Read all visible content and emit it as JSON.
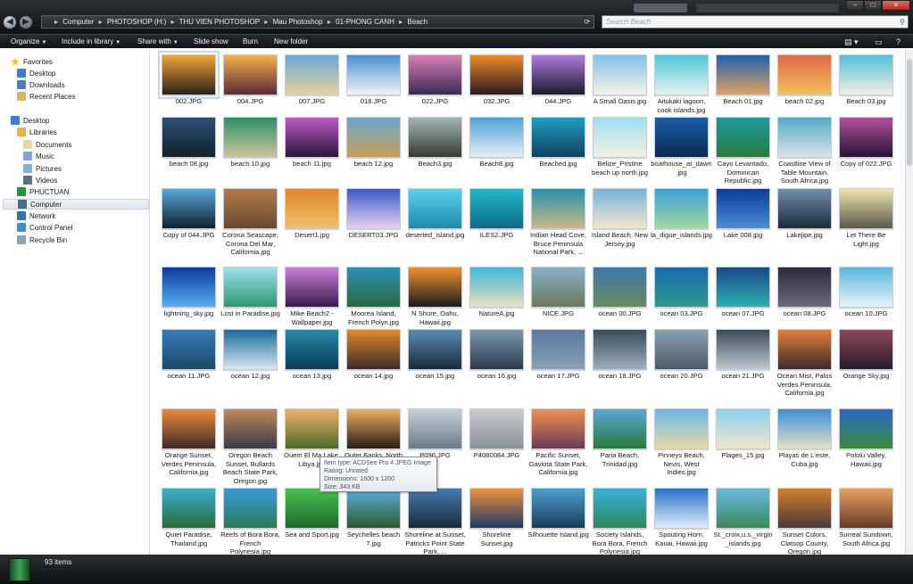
{
  "window": {
    "controls": {
      "min": "–",
      "max": "□",
      "close": "✕"
    }
  },
  "address": {
    "back_icon": "arrow-left-icon",
    "forward_icon": "arrow-right-icon",
    "crumbs": [
      "Computer",
      "PHOTOSHOP (H:)",
      "THU VIEN PHOTOSHOP",
      "Mau Photoshop",
      "01-PHONG CANH",
      "Beach"
    ],
    "separator": "▸",
    "search_placeholder": "Search Beach"
  },
  "toolbar": {
    "organize": "Organize",
    "include": "Include in library",
    "share": "Share with",
    "slideshow": "Slide show",
    "burn": "Burn",
    "newfolder": "New folder"
  },
  "nav": {
    "favorites": "Favorites",
    "desktop_fav": "Desktop",
    "downloads": "Downloads",
    "recent": "Recent Places",
    "desktop": "Desktop",
    "libraries": "Libraries",
    "documents": "Documents",
    "music": "Music",
    "pictures": "Pictures",
    "videos": "Videos",
    "user": "PHUCTUAN",
    "computer": "Computer",
    "network": "Network",
    "control": "Control Panel",
    "recycle": "Recycle Bin"
  },
  "tooltip": {
    "type": "Item type: ACDSee Pro 4 JPEG Image",
    "rating": "Rating: Unrated",
    "dims": "Dimensions: 1600 x 1200",
    "size": "Size: 343 KB"
  },
  "status": {
    "count": "93 items"
  },
  "files": [
    {
      "name": "002.JPG",
      "c1": "#f2a43a",
      "c2": "#2a1f1a"
    },
    {
      "name": "004.JPG",
      "c1": "#f6b04b",
      "c2": "#5a2a3a"
    },
    {
      "name": "007.JPG",
      "c1": "#6aa8d8",
      "c2": "#e6d29a"
    },
    {
      "name": "018.JPG",
      "c1": "#4a8fd0",
      "c2": "#f1f5f7"
    },
    {
      "name": "022.JPG",
      "c1": "#d77fb3",
      "c2": "#3a2a55"
    },
    {
      "name": "032.JPG",
      "c1": "#f08a2a",
      "c2": "#2a1a20"
    },
    {
      "name": "044.JPG",
      "c1": "#b07adf",
      "c2": "#1a1a2e"
    },
    {
      "name": "A Small Oasis.jpg",
      "c1": "#7fc3ea",
      "c2": "#f7f2e8"
    },
    {
      "name": "Aitukaki lagoon, cook islands.jpg",
      "c1": "#51c6d8",
      "c2": "#e5f4ef"
    },
    {
      "name": "Beach 01.jpg",
      "c1": "#1f5fb0",
      "c2": "#e0a060"
    },
    {
      "name": "beach 02.jpg",
      "c1": "#e06a4a",
      "c2": "#f2c15a"
    },
    {
      "name": "Beach 03.jpg",
      "c1": "#52c0d6",
      "c2": "#f4efe3"
    },
    {
      "name": "beach 08.jpg",
      "c1": "#2d4f78",
      "c2": "#12202d"
    },
    {
      "name": "beach 10.jpg",
      "c1": "#2b8f6a",
      "c2": "#d0c49a"
    },
    {
      "name": "beach 11.jpg",
      "c1": "#c05cc8",
      "c2": "#2a1638"
    },
    {
      "name": "beach 12.jpg",
      "c1": "#6aa6d0",
      "c2": "#caa052"
    },
    {
      "name": "Beach3.jpg",
      "c1": "#9fb5b8",
      "c2": "#3a3a2e"
    },
    {
      "name": "Beach8.jpg",
      "c1": "#4ea2d6",
      "c2": "#e6f0f5"
    },
    {
      "name": "Beached.jpg",
      "c1": "#1e9ec2",
      "c2": "#114060"
    },
    {
      "name": "Belize_Pristine beach up north.jpg",
      "c1": "#a0dff2",
      "c2": "#f3efe3"
    },
    {
      "name": "boathouse_at_dawn.jpg",
      "c1": "#1b5ea6",
      "c2": "#0a2a52"
    },
    {
      "name": "Cayo Levantado, Dominican Republic.jpg",
      "c1": "#1c9b9b",
      "c2": "#2a7a3a"
    },
    {
      "name": "Coastline View of Table Mountain, South Africa.jpg",
      "c1": "#56a9c8",
      "c2": "#d8e4e8"
    },
    {
      "name": "Copy of 022.JPG",
      "c1": "#b4509a",
      "c2": "#241436"
    },
    {
      "name": "Copy of 044.JPG",
      "c1": "#5aa8d8",
      "c2": "#102030"
    },
    {
      "name": "Corona Seascape, Corona Del Mar, California.jpg",
      "c1": "#b07a4a",
      "c2": "#6a4a30"
    },
    {
      "name": "Desert1.jpg",
      "c1": "#e0862a",
      "c2": "#f2c06a"
    },
    {
      "name": "DESERT03.JPG",
      "c1": "#3a5ac8",
      "c2": "#e8d0f0"
    },
    {
      "name": "deserted_island.jpg",
      "c1": "#5fd0ea",
      "c2": "#1a8ab0"
    },
    {
      "name": "ILES2.JPG",
      "c1": "#22b8c8",
      "c2": "#0c6a8a"
    },
    {
      "name": "Indian Head Cove, Bruce Peninsula National Park, ...",
      "c1": "#2a90a8",
      "c2": "#c9b98a"
    },
    {
      "name": "Island Beach, New Jersey.jpg",
      "c1": "#7ab4d8",
      "c2": "#efe6d0"
    },
    {
      "name": "la_digue_islands.jpg",
      "c1": "#3aa0d6",
      "c2": "#a0d8a0"
    },
    {
      "name": "Lake 008.jpg",
      "c1": "#0c3a9a",
      "c2": "#4a90d8"
    },
    {
      "name": "Lakejipe.jpg",
      "c1": "#6f8fa8",
      "c2": "#1a2a3a"
    },
    {
      "name": "Let There Be Light.jpg",
      "c1": "#f0e2b0",
      "c2": "#5a5a4a"
    },
    {
      "name": "lightning_sky.jpg",
      "c1": "#0a3aa0",
      "c2": "#58b0f0"
    },
    {
      "name": "Lost in Paradise.jpg",
      "c1": "#9ee0f0",
      "c2": "#2a9a6a"
    },
    {
      "name": "Mike Beach2 - Wallpaper.jpg",
      "c1": "#c880d8",
      "c2": "#3a1a4a"
    },
    {
      "name": "Moorea Island, French Polyn.jpg",
      "c1": "#2a8fb8",
      "c2": "#2a6a3a"
    },
    {
      "name": "N Shore, Oahu, Hawaii.jpg",
      "c1": "#f09030",
      "c2": "#1a1a22"
    },
    {
      "name": "NatureA.jpg",
      "c1": "#3fb8d8",
      "c2": "#e8e0c0"
    },
    {
      "name": "NICE.JPG",
      "c1": "#8ab0c8",
      "c2": "#6a7a5a"
    },
    {
      "name": "ocean 00.JPG",
      "c1": "#3a7ab0",
      "c2": "#6a8a5a"
    },
    {
      "name": "ocean 03.JPG",
      "c1": "#1a6ab0",
      "c2": "#2a9a8a"
    },
    {
      "name": "ocean 07.JPG",
      "c1": "#1a4a8a",
      "c2": "#2ab0b0"
    },
    {
      "name": "ocean 08.JPG",
      "c1": "#2a2a3a",
      "c2": "#6a6a7a"
    },
    {
      "name": "ocean 10.JPG",
      "c1": "#5ab8e0",
      "c2": "#e6f2f8"
    },
    {
      "name": "ocean 11.JPG",
      "c1": "#3a7ab8",
      "c2": "#1a4a6a"
    },
    {
      "name": "ocean 12.jpg",
      "c1": "#1a6a9a",
      "c2": "#d8e8f0"
    },
    {
      "name": "ocean 13.jpg",
      "c1": "#2a8aaa",
      "c2": "#0a3a5a"
    },
    {
      "name": "ocean 14.jpg",
      "c1": "#e08a2a",
      "c2": "#3a2a2a"
    },
    {
      "name": "ocean 15.jpg",
      "c1": "#5a8ab0",
      "c2": "#1a2a3a"
    },
    {
      "name": "ocean 16.jpg",
      "c1": "#7a9ab0",
      "c2": "#2a3a4a"
    },
    {
      "name": "ocean 17.JPG",
      "c1": "#5a7aa0",
      "c2": "#8aa0b8"
    },
    {
      "name": "ocean 18.JPG",
      "c1": "#3a4a5a",
      "c2": "#9ab0c0"
    },
    {
      "name": "ocean 20.JPG",
      "c1": "#8aa0b0",
      "c2": "#4a5a6a"
    },
    {
      "name": "ocean 21.JPG",
      "c1": "#3a4a5a",
      "c2": "#c0c8d0"
    },
    {
      "name": "Ocean Mist, Palos Verdes Peninsula, California.jpg",
      "c1": "#e08040",
      "c2": "#3a2a2a"
    },
    {
      "name": "Orange Sky.jpg",
      "c1": "#8a4a5a",
      "c2": "#2a1a2a"
    },
    {
      "name": "Orange Sunset, Verdes Peninsula, California.jpg",
      "c1": "#f08a3a",
      "c2": "#3a2a2a"
    },
    {
      "name": "Oregon Beach Sunset, Bullards Beach State Park, Oregon.jpg",
      "c1": "#c08a5a",
      "c2": "#3a3a4a"
    },
    {
      "name": "Ouem El Ma Lake, Libya.jpg",
      "c1": "#f0b06a",
      "c2": "#4a6a2a"
    },
    {
      "name": "Outer Banks, North Carolina.jpg",
      "c1": "#f0b060",
      "c2": "#2a1a1a"
    },
    {
      "name": "P096.JPG",
      "c1": "#c8d0d8",
      "c2": "#6a7a8a"
    },
    {
      "name": "P4080084.JPG",
      "c1": "#c8ccd0",
      "c2": "#8a9098"
    },
    {
      "name": "Pacific Sunset, Gaviota State Park, California.jpg",
      "c1": "#f09050",
      "c2": "#6a3a5a"
    },
    {
      "name": "Paria Beach, Trinidad.jpg",
      "c1": "#5aa8d8",
      "c2": "#2a7a3a"
    },
    {
      "name": "Pinneys Beach, Nevis, West Indies.jpg",
      "c1": "#6ab8e8",
      "c2": "#e8d8a8"
    },
    {
      "name": "Plages_15.jpg",
      "c1": "#8ad0f0",
      "c2": "#f2e6c8"
    },
    {
      "name": "Playas de L'este, Cuba.jpg",
      "c1": "#3a90d8",
      "c2": "#e8e0c8"
    },
    {
      "name": "Pololu Valley, Hawaii.jpg",
      "c1": "#2a6ac8",
      "c2": "#3a8a3a"
    },
    {
      "name": "Quiet Paradise, Thailand.jpg",
      "c1": "#3ab0c8",
      "c2": "#2a6a3a"
    },
    {
      "name": "Reefs of Bora Bora, French Polynesia.jpg",
      "c1": "#3a9ad8",
      "c2": "#2a7a5a"
    },
    {
      "name": "Sea and Sport.jpg",
      "c1": "#48c050",
      "c2": "#1a6a2a"
    },
    {
      "name": "Seychelles beach 7.jpg",
      "c1": "#5ab0e0",
      "c2": "#2a5a2a"
    },
    {
      "name": "Shoreline at Sunset, Patricks Point State Park, ...",
      "c1": "#4a7ab0",
      "c2": "#1a2a3a"
    },
    {
      "name": "Shoreline Sunset.jpg",
      "c1": "#f0903a",
      "c2": "#1a3a6a"
    },
    {
      "name": "Silhouette Island.jpg",
      "c1": "#4aa0d0",
      "c2": "#1a3a5a"
    },
    {
      "name": "Society Islands, Bora Bora, French Polynesia.jpg",
      "c1": "#3ab0d8",
      "c2": "#2a8a5a"
    },
    {
      "name": "Spouting Horn, Kauai, Hawaii.jpg",
      "c1": "#2a70c8",
      "c2": "#e0f0f8"
    },
    {
      "name": "St._croix,u.s._virgin_islands.jpg",
      "c1": "#6ab8e0",
      "c2": "#3a8a5a"
    },
    {
      "name": "Sunset Colors, Clatsop County, Oregon.jpg",
      "c1": "#d08030",
      "c2": "#4a3a3a"
    },
    {
      "name": "Surreal Sundown, South Africa.jpg",
      "c1": "#e8a060",
      "c2": "#6a3a2a"
    }
  ]
}
